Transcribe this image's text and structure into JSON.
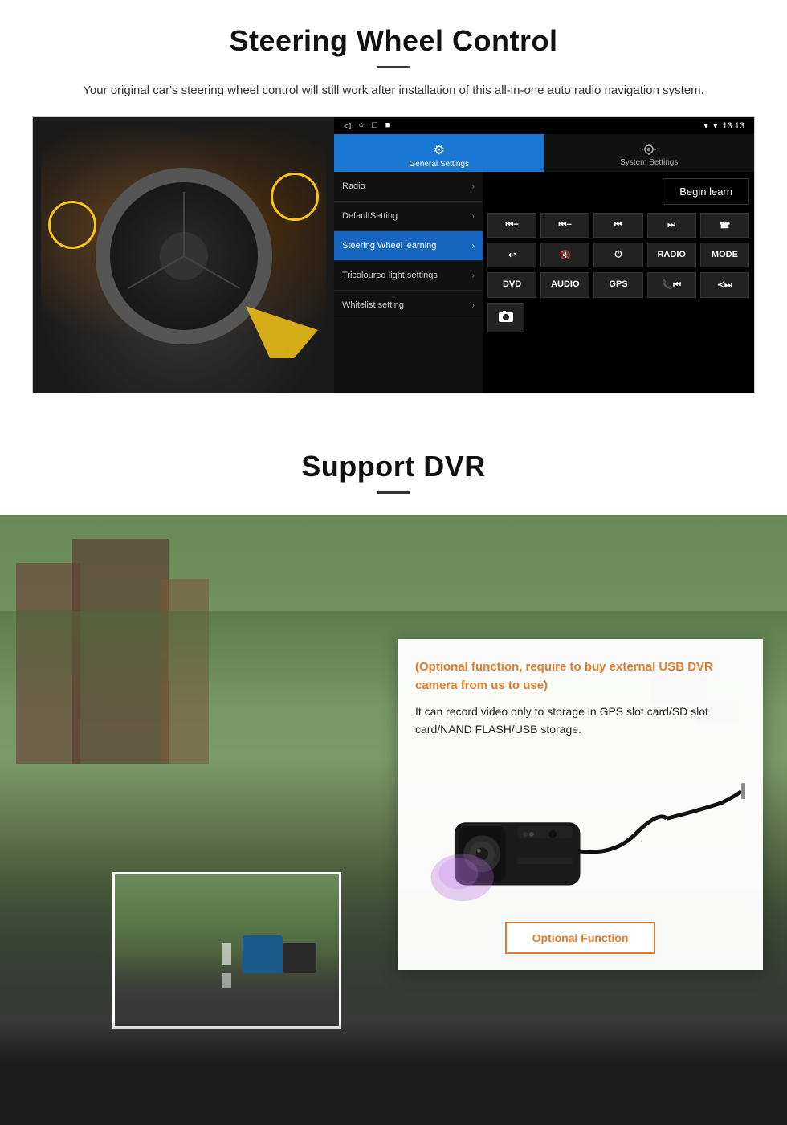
{
  "steering": {
    "title": "Steering Wheel Control",
    "subtitle": "Your original car's steering wheel control will still work after installation of this all-in-one auto radio navigation system.",
    "statusbar": {
      "nav_icons": "◁  ○  □  ■",
      "signal": "▼",
      "time": "13:13",
      "wifi": "▾"
    },
    "topbar": {
      "general_settings_label": "General Settings",
      "system_settings_label": "System Settings"
    },
    "menu_items": [
      {
        "label": "Radio",
        "active": false
      },
      {
        "label": "DefaultSetting",
        "active": false
      },
      {
        "label": "Steering Wheel learning",
        "active": true
      },
      {
        "label": "Tricoloured light settings",
        "active": false
      },
      {
        "label": "Whitelist setting",
        "active": false
      }
    ],
    "begin_learn": "Begin learn",
    "ctrl_buttons_row1": [
      "⏮+",
      "⏮−",
      "⏮",
      "⏭",
      "☎"
    ],
    "ctrl_buttons_row2": [
      "↩",
      "🔇x",
      "⏻",
      "RADIO",
      "MODE"
    ],
    "ctrl_buttons_row3": [
      "DVD",
      "AUDIO",
      "GPS",
      "📞⏮",
      "≺⏭"
    ],
    "ctrl_buttons_row4": [
      "📷"
    ]
  },
  "dvr": {
    "title": "Support DVR",
    "optional_text": "(Optional function, require to buy external USB DVR camera from us to use)",
    "description": "It can record video only to storage in GPS slot card/SD slot card/NAND FLASH/USB storage.",
    "optional_function_label": "Optional Function"
  }
}
